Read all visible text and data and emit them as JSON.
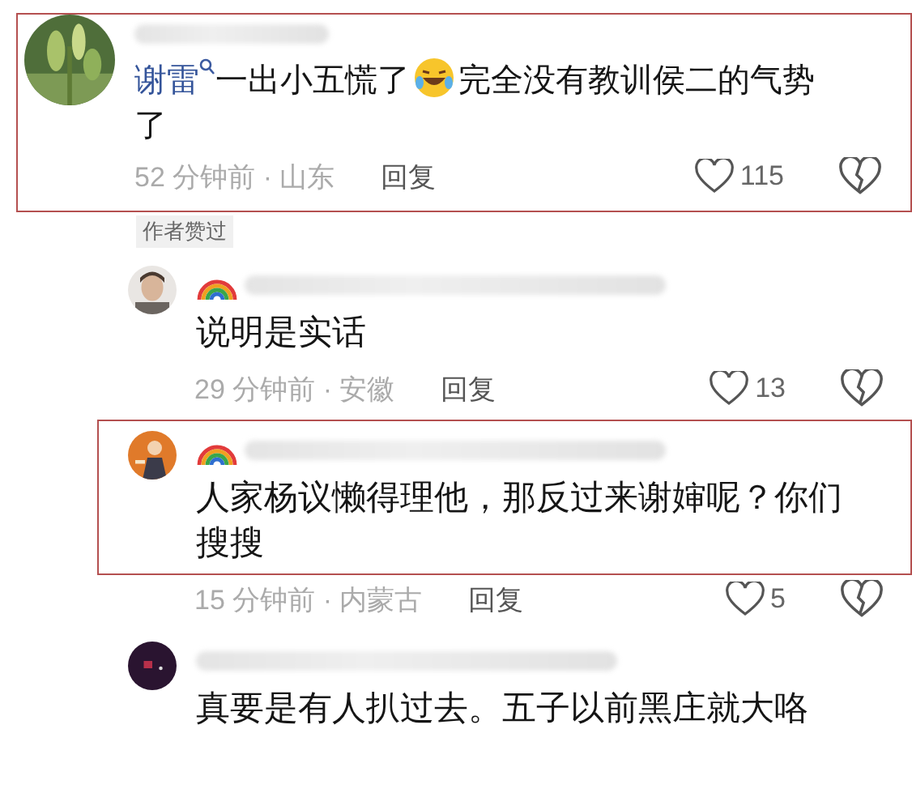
{
  "comments": [
    {
      "highlighted": true,
      "segments": [
        {
          "kind": "link",
          "text": "谢雷"
        },
        {
          "kind": "text",
          "text": "一出小五慌了"
        },
        {
          "kind": "emoji"
        },
        {
          "kind": "text",
          "text": "完全没有教训侯二的气势了"
        }
      ],
      "meta": "52 分钟前 · 山东",
      "reply": "回复",
      "likes": "115",
      "badge": "作者赞过",
      "children": [
        {
          "highlighted": false,
          "rainbow_badge": true,
          "segments": [
            {
              "kind": "text",
              "text": "说明是实话"
            }
          ],
          "meta": "29 分钟前 · 安徽",
          "reply": "回复",
          "likes": "13"
        },
        {
          "highlighted": true,
          "rainbow_badge": true,
          "segments": [
            {
              "kind": "text",
              "text": "人家杨议懒得理他，那反过来谢婶呢？你们搜搜"
            }
          ],
          "meta": "15 分钟前 · 内蒙古",
          "reply": "回复",
          "likes": "5"
        },
        {
          "highlighted": false,
          "segments": [
            {
              "kind": "text",
              "text": "真要是有人扒过去。五子以前黑庄就大咯"
            }
          ]
        }
      ]
    }
  ]
}
